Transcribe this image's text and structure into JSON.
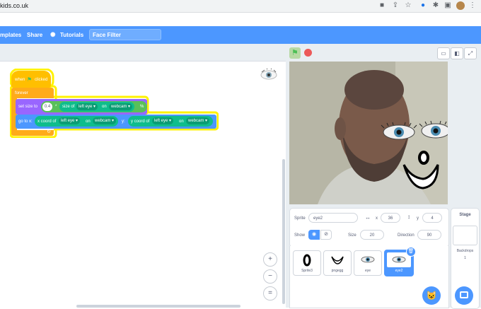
{
  "browser": {
    "url": "kids.co.uk",
    "icons": [
      "camera-icon",
      "share-icon",
      "star-icon",
      "drop-icon",
      "puzzle-icon",
      "sidepanel-icon",
      "avatar",
      "menu-icon"
    ]
  },
  "menu": {
    "templates": "mplates",
    "share": "Share",
    "tutorials": "Tutorials",
    "project_title": "Face Filter"
  },
  "blocks": {
    "hat": {
      "when": "when",
      "clicked": "clicked"
    },
    "forever": "forever",
    "set_size": {
      "label": "set size to",
      "x": "0.4",
      "mult": "*",
      "size_of": "size of",
      "target": "left eye",
      "on": "on",
      "source": "webcam",
      "percent": "%"
    },
    "go_to": {
      "label": "go to x:",
      "xcoord": "x coord of",
      "target1": "left eye",
      "on1": "on",
      "source1": "webcam",
      "y": "y:",
      "ycoord": "y coord of",
      "target2": "left eye",
      "on2": "on",
      "source2": "webcam"
    }
  },
  "zoom": {
    "in": "+",
    "out": "−",
    "reset": "="
  },
  "sprite_info": {
    "sprite_label": "Sprite",
    "sprite_name": "eye2",
    "x_label": "x",
    "x_value": "36",
    "y_label": "y",
    "y_value": "4",
    "show_label": "Show",
    "size_label": "Size",
    "size_value": "20",
    "direction_label": "Direction",
    "direction_value": "90"
  },
  "sprites": [
    {
      "name": "Sprite3"
    },
    {
      "name": "pngegg"
    },
    {
      "name": "eye"
    },
    {
      "name": "eye2"
    }
  ],
  "stage_panel": {
    "title": "Stage",
    "backdrops_label": "Backdrops",
    "backdrops_count": "1"
  },
  "colors": {
    "menu": "#4c97ff",
    "events": "#ffbf00",
    "control": "#ffab19",
    "looks": "#9966ff",
    "motion": "#4c97ff",
    "video": "#0fbd8c",
    "operators": "#59c059"
  }
}
